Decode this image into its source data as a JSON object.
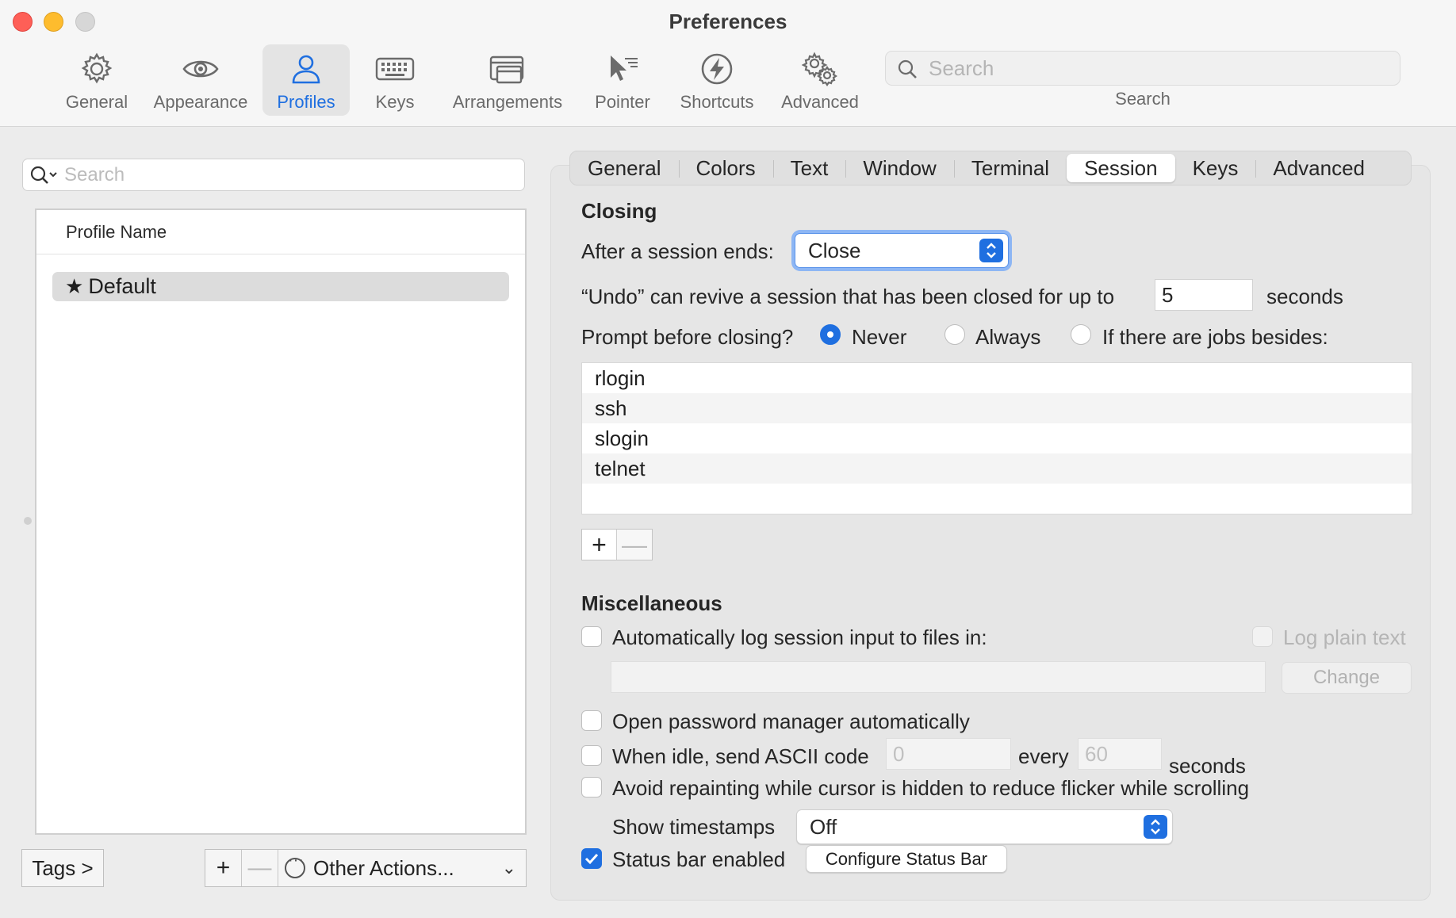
{
  "window": {
    "title": "Preferences"
  },
  "toolbar": {
    "items": [
      {
        "label": "General",
        "icon": "gear-icon"
      },
      {
        "label": "Appearance",
        "icon": "eye-icon"
      },
      {
        "label": "Profiles",
        "icon": "person-icon",
        "active": true
      },
      {
        "label": "Keys",
        "icon": "keyboard-icon"
      },
      {
        "label": "Arrangements",
        "icon": "windows-icon"
      },
      {
        "label": "Pointer",
        "icon": "pointer-icon"
      },
      {
        "label": "Shortcuts",
        "icon": "bolt-icon"
      },
      {
        "label": "Advanced",
        "icon": "gears-icon"
      }
    ],
    "search_placeholder": "Search",
    "search_label": "Search"
  },
  "sidebar": {
    "search_placeholder": "Search",
    "column_header": "Profile Name",
    "profiles": [
      {
        "name": "Default",
        "star": "★"
      }
    ],
    "tags_button": "Tags >",
    "add_label": "+",
    "remove_label": "—",
    "other_actions": "Other Actions...",
    "chevron": "⌄"
  },
  "tabs": [
    "General",
    "Colors",
    "Text",
    "Window",
    "Terminal",
    "Session",
    "Keys",
    "Advanced"
  ],
  "active_tab": "Session",
  "closing": {
    "title": "Closing",
    "after_session_label": "After a session ends:",
    "after_session_value": "Close",
    "undo_label": "“Undo” can revive a session that has been closed for up to",
    "undo_value": "5",
    "undo_unit": "seconds",
    "prompt_label": "Prompt before closing?",
    "prompt_options": [
      {
        "label": "Never",
        "selected": true
      },
      {
        "label": "Always",
        "selected": false
      },
      {
        "label": "If there are jobs besides:",
        "selected": false
      }
    ],
    "jobs": [
      "rlogin",
      "ssh",
      "slogin",
      "telnet"
    ],
    "add_label": "+",
    "remove_label": "—"
  },
  "misc": {
    "title": "Miscellaneous",
    "auto_log_label": "Automatically log session input to files in:",
    "log_plain_text_label": "Log plain text",
    "change_button": "Change",
    "password_manager_label": "Open password manager automatically",
    "idle_label": "When idle, send ASCII code",
    "idle_code": "0",
    "every_label": "every",
    "idle_seconds": "60",
    "idle_unit": "seconds",
    "avoid_repaint_label": "Avoid repainting while cursor is hidden to reduce flicker while scrolling",
    "timestamps_label": "Show timestamps",
    "timestamps_value": "Off",
    "status_bar_label": "Status bar enabled",
    "status_bar_checked": true,
    "configure_button": "Configure Status Bar"
  },
  "colors": {
    "accent": "#1f6fe0",
    "close": "#fe5f57",
    "minimize": "#febc2e",
    "zoom": "#d7d7d7"
  }
}
